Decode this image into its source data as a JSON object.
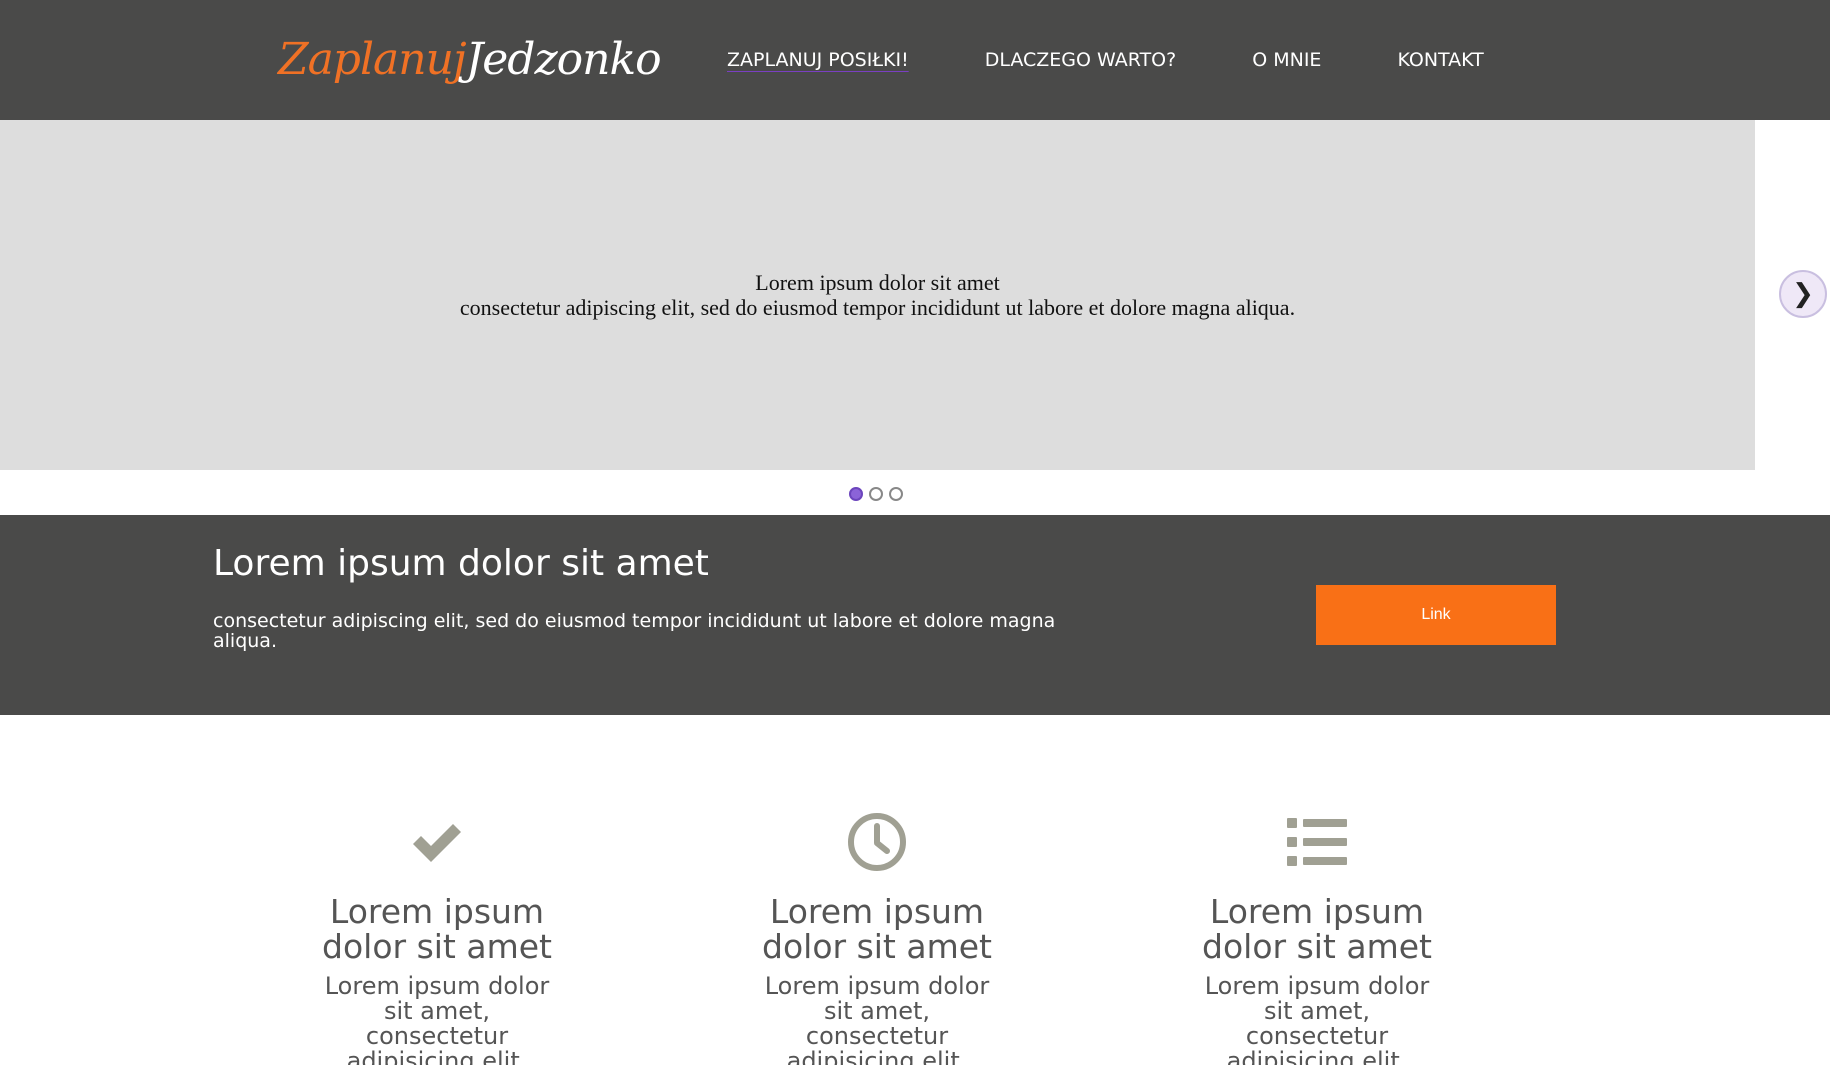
{
  "header": {
    "logo": {
      "part1": "Zaplanuj",
      "part2": "Jedzonko"
    },
    "nav": [
      {
        "label": "ZAPLANUJ POSIŁKI!"
      },
      {
        "label": "DLACZEGO WARTO?"
      },
      {
        "label": "O MNIE"
      },
      {
        "label": "KONTAKT"
      }
    ]
  },
  "slider": {
    "line1": "Lorem ipsum dolor sit amet",
    "line2": "consectetur adipiscing elit, sed do eiusmod tempor incididunt ut labore et dolore magna aliqua.",
    "next_symbol": "❯",
    "active_slide": 1,
    "slide_count": 3
  },
  "cta": {
    "title": "Lorem ipsum dolor sit amet",
    "text": "consectetur adipiscing elit, sed do eiusmod tempor incididunt ut labore et dolore magna aliqua.",
    "button_label": "Link"
  },
  "features": [
    {
      "icon": "checkmark-icon",
      "title": "Lorem ipsum dolor sit amet",
      "text": "Lorem ipsum dolor sit amet, consectetur adipisicing elit."
    },
    {
      "icon": "clock-icon",
      "title": "Lorem ipsum dolor sit amet",
      "text": "Lorem ipsum dolor sit amet, consectetur adipisicing elit."
    },
    {
      "icon": "list-icon",
      "title": "Lorem ipsum dolor sit amet",
      "text": "Lorem ipsum dolor sit amet, consectetur adipisicing elit."
    }
  ],
  "colors": {
    "header_bg": "#4a4a49",
    "accent_orange": "#f97016",
    "logo_orange": "#f07125",
    "slide_bg": "#dddddd",
    "icon_gray": "#a0a093",
    "active_dot": "#8b63d8"
  }
}
